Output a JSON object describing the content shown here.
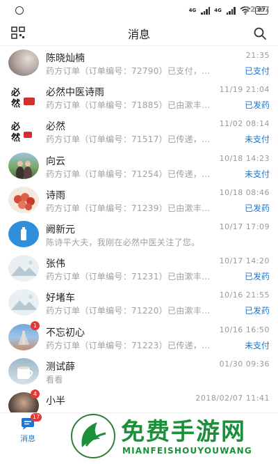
{
  "status_bar": {
    "time": "22:27",
    "network_1": "4G",
    "network_2": "4G",
    "battery": "87"
  },
  "header": {
    "title": "消息"
  },
  "messages": [
    {
      "name": "陈晓灿楠",
      "time": "21:35",
      "preview": "药方订单（订单编号：72790）已支付，...",
      "status": "已支付",
      "badge": ""
    },
    {
      "name": "必然中医诗雨",
      "time": "11/19 21:04",
      "preview": "药方订单（订单编号：71885）已由漱丰...",
      "status": "已发药",
      "badge": ""
    },
    {
      "name": "必然",
      "time": "11/02 08:14",
      "preview": "药方订单（订单编号：71517）已传递，...",
      "status": "未支付",
      "badge": ""
    },
    {
      "name": "向云",
      "time": "10/18 14:23",
      "preview": "药方订单（订单编号：71254）已传递，...",
      "status": "未支付",
      "badge": ""
    },
    {
      "name": "诗雨",
      "time": "10/18 08:46",
      "preview": "药方订单（订单编号：71239）已由漱丰...",
      "status": "已发药",
      "badge": ""
    },
    {
      "name": "阙新元",
      "time": "10/17 17:09",
      "preview": "陈诗平大夫，我刚在必然中医关注了您。",
      "status": "",
      "badge": ""
    },
    {
      "name": "张伟",
      "time": "10/17 14:20",
      "preview": "药方订单（订单编号：71231）已由漱丰...",
      "status": "已发药",
      "badge": ""
    },
    {
      "name": "好堵车",
      "time": "10/16 21:55",
      "preview": "药方订单（订单编号：71220）已由漱丰...",
      "status": "已发药",
      "badge": ""
    },
    {
      "name": "不忘初心",
      "time": "10/16 16:50",
      "preview": "药方订单（订单编号：71223）已传递，...",
      "status": "未支付",
      "badge": "1"
    },
    {
      "name": "测试薛",
      "time": "01/30 09:36",
      "preview": "看看",
      "status": "",
      "badge": ""
    },
    {
      "name": "小半",
      "time": "2018/02/07 11:41",
      "preview": "",
      "status": "",
      "badge": "4"
    }
  ],
  "tabbar": {
    "messages_label": "消息",
    "messages_badge": "17"
  },
  "watermark": {
    "text_cn": "免费手游网",
    "text_en": "MIANFEISHOUYOUWANG"
  },
  "colors": {
    "accent": "#1976d2",
    "badge": "#e53935",
    "watermark": "#1b8f3a"
  }
}
